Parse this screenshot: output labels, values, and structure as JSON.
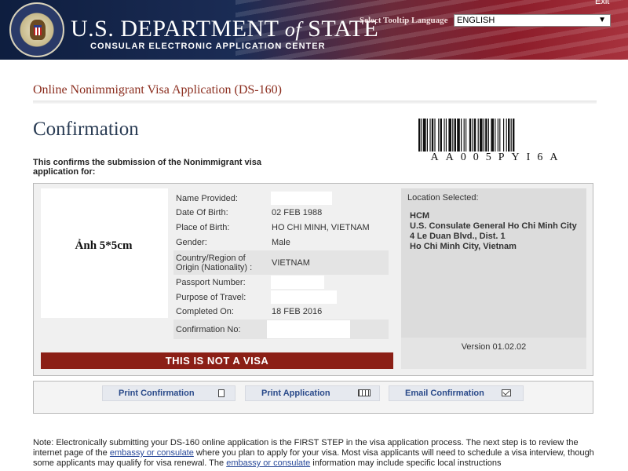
{
  "header": {
    "title_prefix": "U.S. DEPARTMENT",
    "title_of": "of",
    "title_suffix": "STATE",
    "subtitle": "CONSULAR ELECTRONIC APPLICATION CENTER",
    "lang_label": "Select Tooltip Language",
    "lang_value": "ENGLISH",
    "exit_label": "Exit"
  },
  "page": {
    "app_title": "Online Nonimmigrant Visa Application (DS-160)",
    "heading": "Confirmation",
    "intro": "This confirms the submission of the Nonimmigrant visa application for:"
  },
  "barcode": {
    "code": "AA005PYI6A"
  },
  "photo": {
    "label": "Ảnh 5*5cm"
  },
  "applicant": {
    "fields": [
      {
        "label": "Name Provided:",
        "value": ""
      },
      {
        "label": "Date Of Birth:",
        "value": "02 FEB 1988"
      },
      {
        "label": "Place of Birth:",
        "value": "HO CHI MINH, VIETNAM"
      },
      {
        "label": "Gender:",
        "value": "Male"
      },
      {
        "label": "Country/Region of Origin (Nationality) :",
        "value": "VIETNAM"
      },
      {
        "label": "Passport Number:",
        "value": ""
      },
      {
        "label": "Purpose of Travel:",
        "value": ""
      },
      {
        "label": "Completed On:",
        "value": "18 FEB 2016"
      },
      {
        "label": "Confirmation No:",
        "value": ""
      }
    ]
  },
  "notice": {
    "not_visa": "THIS IS NOT A VISA"
  },
  "location": {
    "heading": "Location Selected:",
    "lines": [
      "HCM",
      "U.S. Consulate General Ho Chi Minh City",
      "4 Le Duan Blvd., Dist. 1",
      "Ho Chi Minh City, Vietnam"
    ],
    "version": "Version 01.02.02"
  },
  "actions": {
    "print_confirmation": "Print Confirmation",
    "print_application": "Print Application",
    "email_confirmation": "Email Confirmation"
  },
  "note": {
    "part1": "Note: Electronically submitting your DS-160 online application is the FIRST STEP in the visa application process. The next step is to review the internet page of the ",
    "link1": "embassy or consulate",
    "part2": " where you plan to apply for your visa. Most visa applicants will need to schedule a visa interview, though some applicants may qualify for visa renewal. The ",
    "link2": "embassy or consulate",
    "part3": " information may include specific local instructions"
  },
  "colors": {
    "header_navy": "#0e1e3f",
    "header_red": "#8c1d2a",
    "title_red": "#8b2d1e",
    "heading_blue": "#2b3d55",
    "not_visa_bg": "#8b1f16",
    "link_blue": "#2a4a9a"
  }
}
